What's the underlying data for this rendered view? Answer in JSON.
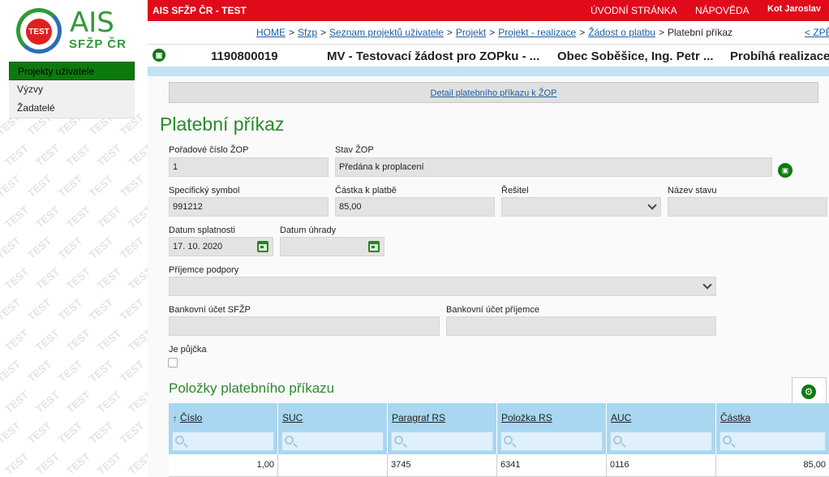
{
  "app": {
    "title": "AIS SFŽP ČR - TEST",
    "logo_badge": "TEST",
    "logo_main": "AIS",
    "logo_sub": "SFŽP ČR",
    "watermark_text": "TEST"
  },
  "topnav": {
    "home": "ÚVODNÍ STRÁNKA",
    "help": "NÁPOVĚDA",
    "user": "Kot Jaroslav"
  },
  "sidebar": {
    "items": [
      {
        "label": "Projekty uživatele",
        "active": true
      },
      {
        "label": "Výzvy",
        "active": false
      },
      {
        "label": "Žadatelé",
        "active": false
      }
    ]
  },
  "breadcrumb": {
    "items": [
      "HOME",
      "Sfzp",
      "Seznam projektů uživatele",
      "Projekt",
      "Projekt - realizace",
      "Žádost o platbu"
    ],
    "separator": ">",
    "current": "Platební příkaz",
    "back": "< ZPĚ"
  },
  "project": {
    "number": "1190800019",
    "name": "MV - Testovací žádost pro ZOPku - ...",
    "organization": "Obec Soběšice, Ing. Petr ...",
    "state": "Probíhá realizace"
  },
  "detail_link": "Detail platebního příkazu k ŽOP",
  "page_title": "Platební příkaz",
  "form": {
    "poradove_cislo": {
      "label": "Pořadové číslo ŽOP",
      "value": "1"
    },
    "stav_zop": {
      "label": "Stav ŽOP",
      "value": "Předána k proplacení"
    },
    "specificky_symbol": {
      "label": "Specifický symbol",
      "value": "991212"
    },
    "castka": {
      "label": "Částka k platbě",
      "value": "85,00"
    },
    "resitel": {
      "label": "Řešitel",
      "value": ""
    },
    "nazev_stavu": {
      "label": "Název stavu",
      "value": ""
    },
    "datum_splatnosti": {
      "label": "Datum splatnosti",
      "value": "17. 10. 2020"
    },
    "datum_uhrady": {
      "label": "Datum úhrady",
      "value": ""
    },
    "prijemce": {
      "label": "Příjemce podpory",
      "value": ""
    },
    "ucet_sfzp": {
      "label": "Bankovní účet SFŽP",
      "value": ""
    },
    "ucet_prijemce": {
      "label": "Bankovní účet příjemce",
      "value": ""
    },
    "je_pujcka": {
      "label": "Je půjčka",
      "checked": false
    }
  },
  "items_section": {
    "title": "Položky platebního příkazu",
    "sort_arrow": "↑",
    "columns": [
      "Číslo",
      "SUC",
      "Paragraf RS",
      "Položka RS",
      "AUC",
      "Částka"
    ],
    "rows": [
      [
        "1,00",
        "",
        "3745",
        "6341",
        "0116",
        "85,00"
      ]
    ]
  },
  "colors": {
    "topbar": "#e00a1a",
    "accent_green": "#2a8a2a",
    "table_header": "#a9d6f0"
  }
}
